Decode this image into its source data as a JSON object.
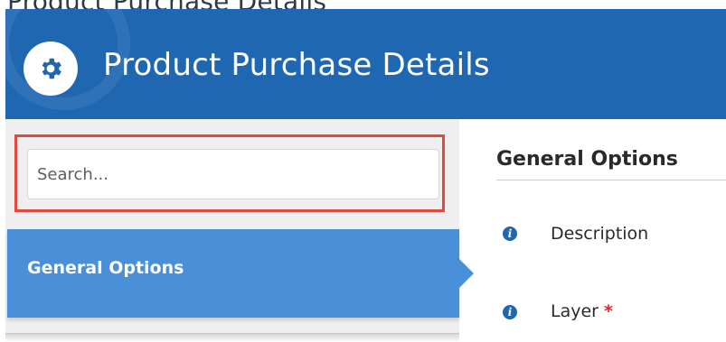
{
  "top_strip": {
    "text": "Product Purchase Details"
  },
  "header": {
    "title": "Product Purchase Details",
    "icon": "gear-icon"
  },
  "sidebar": {
    "search": {
      "placeholder": "Search...",
      "value": ""
    },
    "items": [
      {
        "label": "General Options",
        "active": true
      }
    ]
  },
  "main": {
    "section_title": "General Options",
    "fields": [
      {
        "label": "Description",
        "required": false,
        "icon": "info-icon"
      },
      {
        "label": "Layer",
        "required": true,
        "required_mark": "*",
        "icon": "info-icon"
      }
    ]
  },
  "colors": {
    "header_bg": "#1f67b1",
    "active_nav_bg": "#4a90d9",
    "highlight_border": "#e34a3f",
    "required_star": "#e02424",
    "sidebar_bg": "#efefef"
  }
}
